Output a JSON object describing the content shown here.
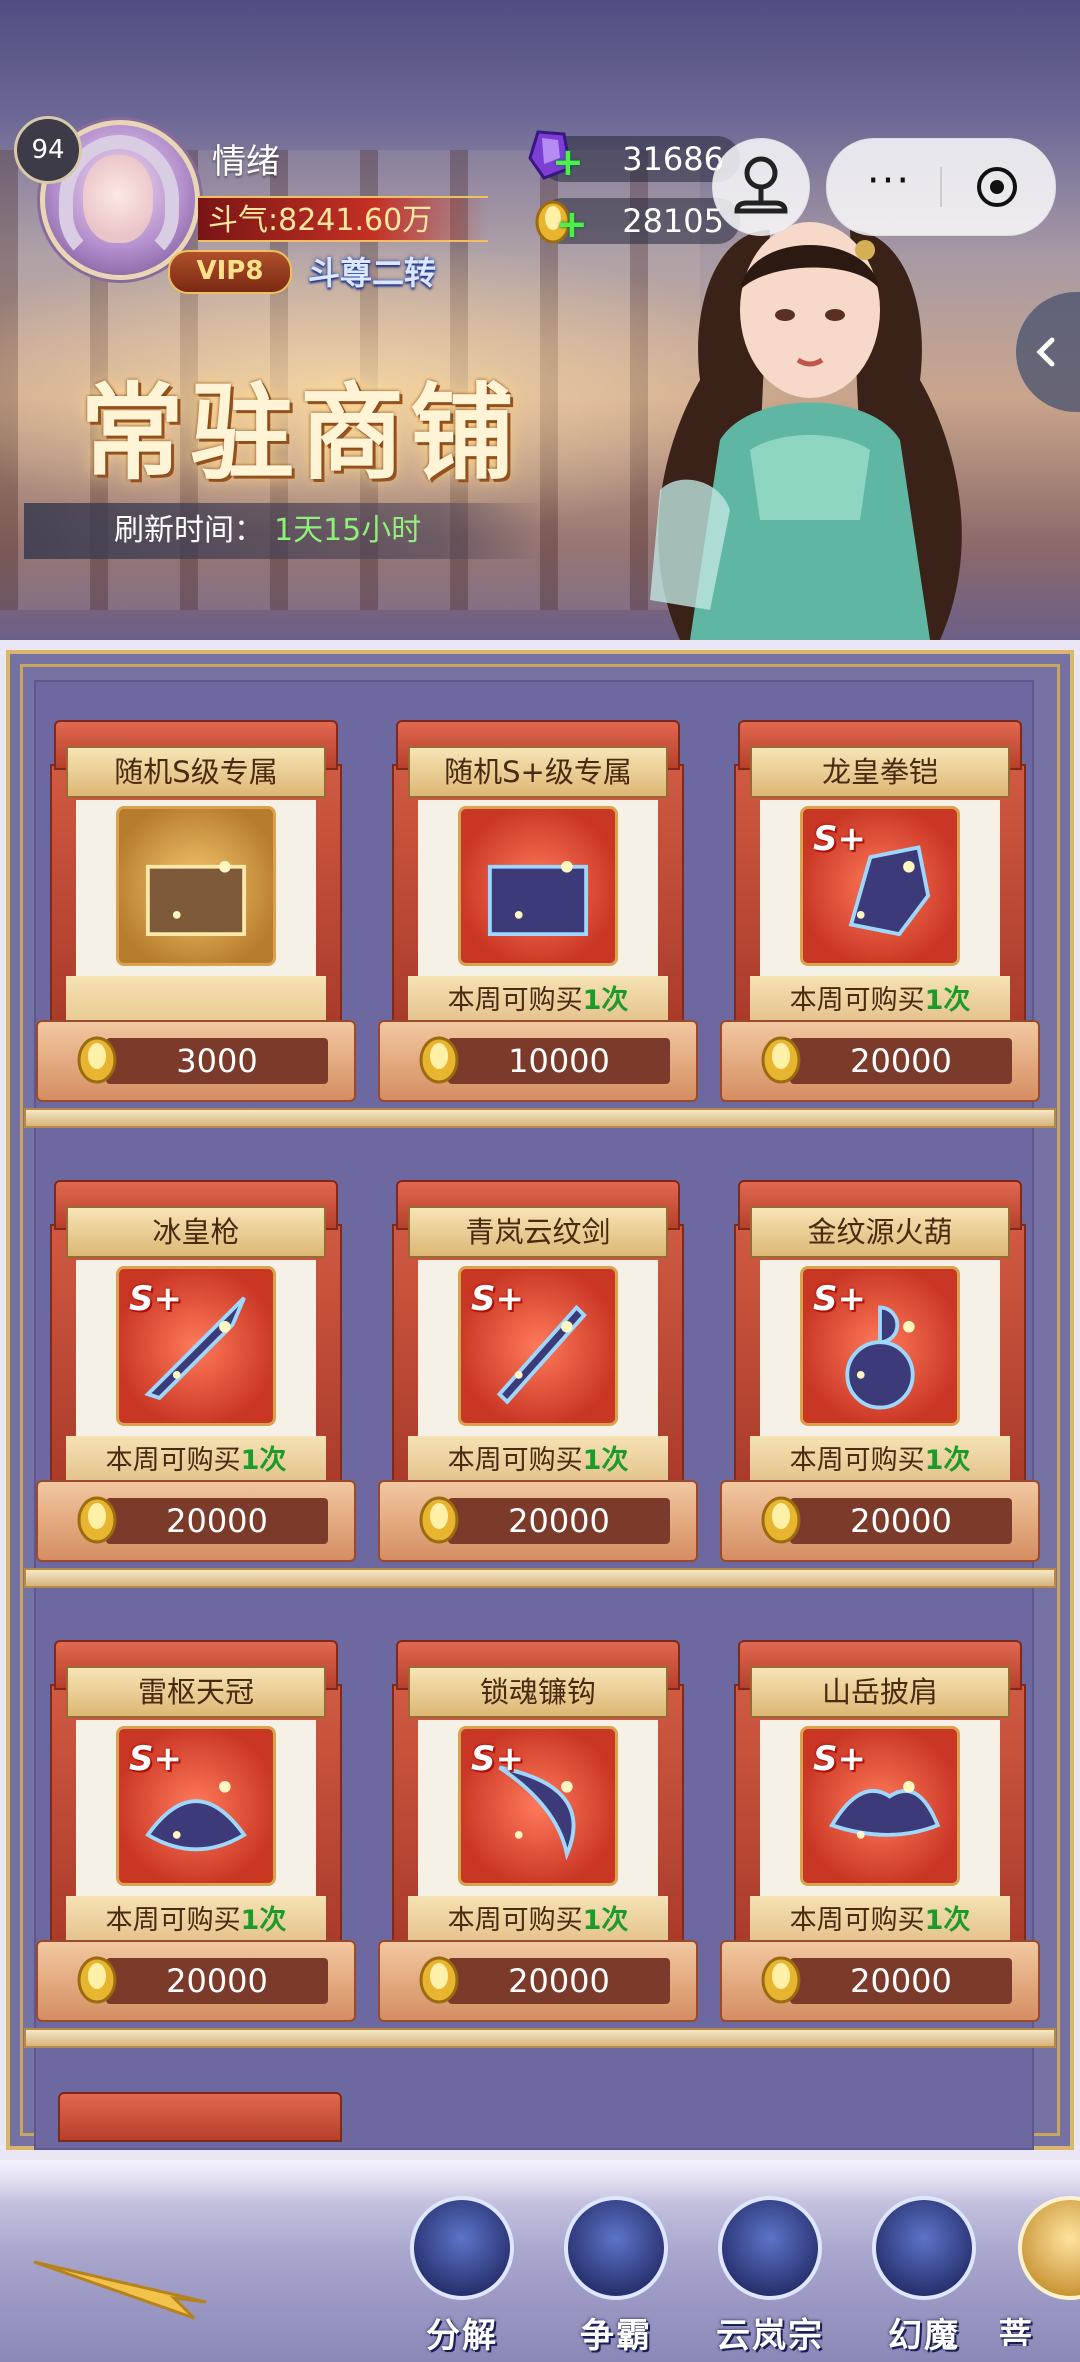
{
  "player": {
    "level": "94",
    "name": "情绪",
    "power_label": "斗气:8241.60万",
    "vip": "VIP8",
    "rank": "斗尊二转"
  },
  "currencies": [
    {
      "icon": "purple-crystal-icon",
      "value": "31686"
    },
    {
      "icon": "gold-ingot-icon",
      "value": "28105"
    }
  ],
  "shop": {
    "title": "常驻商铺",
    "refresh_label": "刷新时间：",
    "refresh_value": "1天15小时"
  },
  "capsule": {
    "more": "···"
  },
  "items": [
    {
      "name": "随机S级专属",
      "badge": "",
      "limit": "",
      "price": "3000",
      "icon": "chest-icon"
    },
    {
      "name": "随机S+级专属",
      "badge": "",
      "limit_prefix": "本周可购买",
      "limit_count": "1次",
      "price": "10000",
      "icon": "chest-icon"
    },
    {
      "name": "龙皇拳铠",
      "badge": "S+",
      "limit_prefix": "本周可购买",
      "limit_count": "1次",
      "price": "20000",
      "icon": "gauntlet-icon"
    },
    {
      "name": "冰皇枪",
      "badge": "S+",
      "limit_prefix": "本周可购买",
      "limit_count": "1次",
      "price": "20000",
      "icon": "spear-icon"
    },
    {
      "name": "青岚云纹剑",
      "badge": "S+",
      "limit_prefix": "本周可购买",
      "limit_count": "1次",
      "price": "20000",
      "icon": "sword-icon"
    },
    {
      "name": "金纹源火葫",
      "badge": "S+",
      "limit_prefix": "本周可购买",
      "limit_count": "1次",
      "price": "20000",
      "icon": "gourd-icon"
    },
    {
      "name": "雷枢天冠",
      "badge": "S+",
      "limit_prefix": "本周可购买",
      "limit_count": "1次",
      "price": "20000",
      "icon": "crown-icon"
    },
    {
      "name": "锁魂镰钩",
      "badge": "S+",
      "limit_prefix": "本周可购买",
      "limit_count": "1次",
      "price": "20000",
      "icon": "sickle-icon"
    },
    {
      "name": "山岳披肩",
      "badge": "S+",
      "limit_prefix": "本周可购买",
      "limit_count": "1次",
      "price": "20000",
      "icon": "shoulder-icon"
    }
  ],
  "nav": [
    {
      "label": "分解",
      "icon": "decompose-icon"
    },
    {
      "label": "争霸",
      "icon": "trophy-icon"
    },
    {
      "label": "云岚宗",
      "icon": "sect-icon"
    },
    {
      "label": "幻魔",
      "icon": "demon-icon"
    },
    {
      "label": "菩",
      "icon": "bodhi-icon"
    }
  ],
  "colors": {
    "accent_gold": "#d9b76a",
    "limit_green": "#1c9a2a",
    "panel_purple": "#6e68a0"
  }
}
